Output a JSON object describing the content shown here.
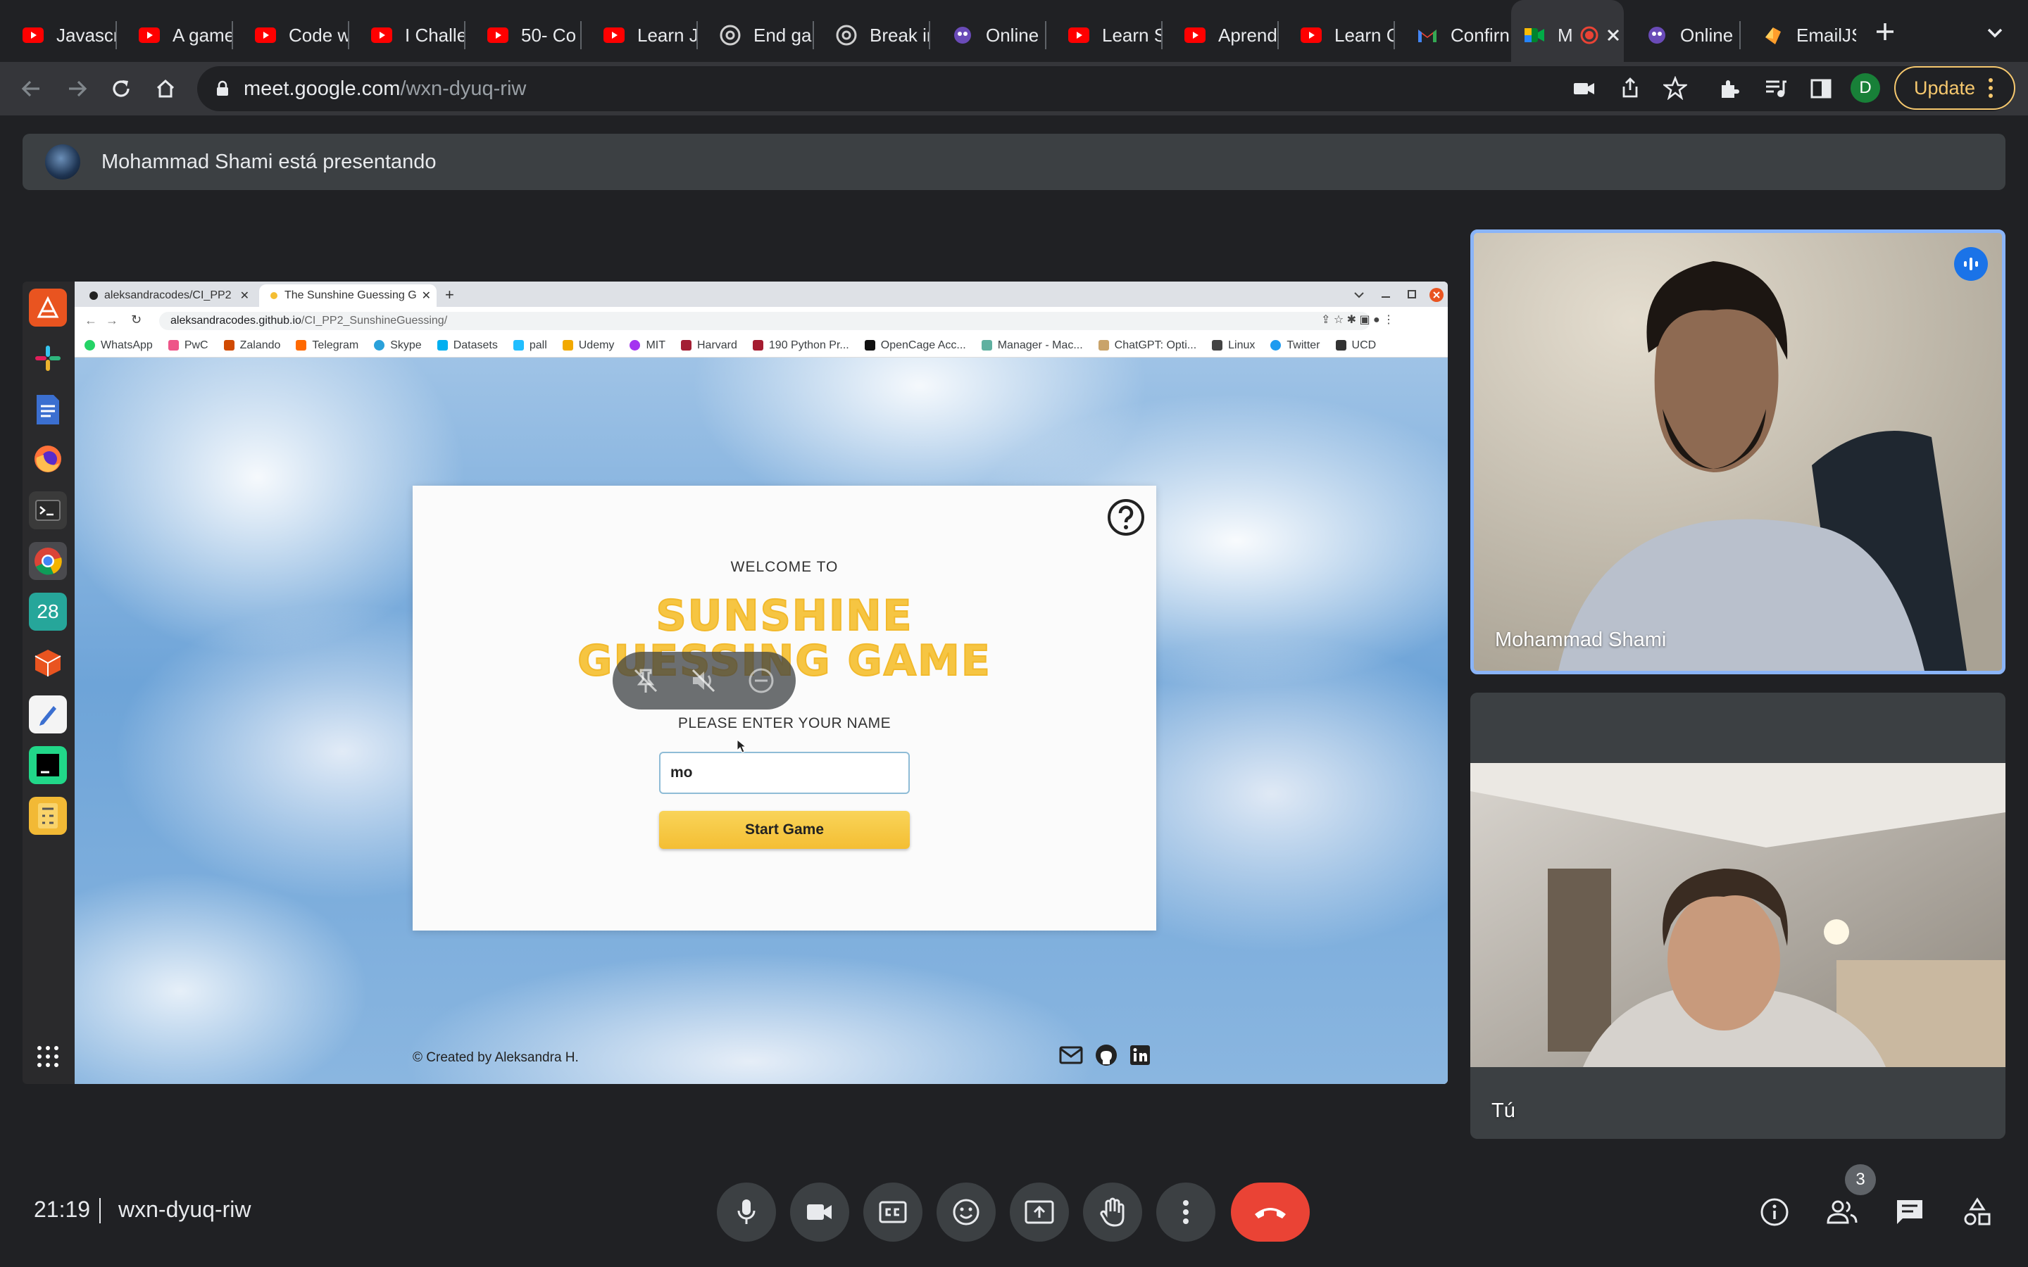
{
  "browser": {
    "tabs": [
      {
        "label": "Javascr",
        "icon": "youtube-icon"
      },
      {
        "label": "A game",
        "icon": "youtube-icon"
      },
      {
        "label": "Code w",
        "icon": "youtube-icon"
      },
      {
        "label": "I Challe",
        "icon": "youtube-icon"
      },
      {
        "label": "50- Co",
        "icon": "youtube-icon"
      },
      {
        "label": "Learn J",
        "icon": "youtube-icon"
      },
      {
        "label": "End gar",
        "icon": "chatgpt-icon"
      },
      {
        "label": "Break ir",
        "icon": "chatgpt-icon"
      },
      {
        "label": "Online (",
        "icon": "globe-icon"
      },
      {
        "label": "Learn S",
        "icon": "youtube-icon"
      },
      {
        "label": "Aprend",
        "icon": "youtube-icon"
      },
      {
        "label": "Learn C",
        "icon": "youtube-icon"
      },
      {
        "label": "Confirn",
        "icon": "gmail-icon"
      },
      {
        "label": "M",
        "icon": "meet-icon"
      },
      {
        "label": "Online",
        "icon": "globe-icon"
      },
      {
        "label": "EmailJS",
        "icon": "emailjs-icon"
      }
    ],
    "url_host": "meet.google.com",
    "url_path": "/wxn-dyuq-riw",
    "profile_initial": "D",
    "update_label": "Update"
  },
  "meet": {
    "presenter_banner": "Mohammad Shami está presentando",
    "meeting_time": "21:19",
    "meeting_code": "wxn-dyuq-riw",
    "participant_count": "3",
    "participants": [
      {
        "name": "Mohammad Shami",
        "speaking": true
      },
      {
        "name": "Tú",
        "speaking": false
      }
    ]
  },
  "shared_screen": {
    "tabs": [
      "aleksandracodes/CI_PP2",
      "The Sunshine Guessing G"
    ],
    "url_host": "aleksandracodes.github.io",
    "url_path": "/CI_PP2_SunshineGuessing/",
    "calendar_day": "28",
    "bookmarks": [
      "WhatsApp",
      "PwC",
      "Zalando",
      "Telegram",
      "Skype",
      "Datasets",
      "pall",
      "Udemy",
      "MIT",
      "Harvard",
      "190 Python Pr...",
      "OpenCage Acc...",
      "Manager - Mac...",
      "ChatGPT: Opti...",
      "Linux",
      "Twitter",
      "UCD"
    ],
    "game": {
      "welcome": "WELCOME TO",
      "title_line1": "SUNSHINE",
      "title_line2": "GUESSING GAME",
      "prompt": "PLEASE ENTER YOUR NAME",
      "name_value": "mo",
      "start_label": "Start Game",
      "footer": "© Created by Aleksandra H."
    }
  },
  "colors": {
    "meet_bg": "#202124",
    "hangup": "#ea4335",
    "speaking_border": "#8ab4f8",
    "game_yellow": "#f6c542"
  }
}
